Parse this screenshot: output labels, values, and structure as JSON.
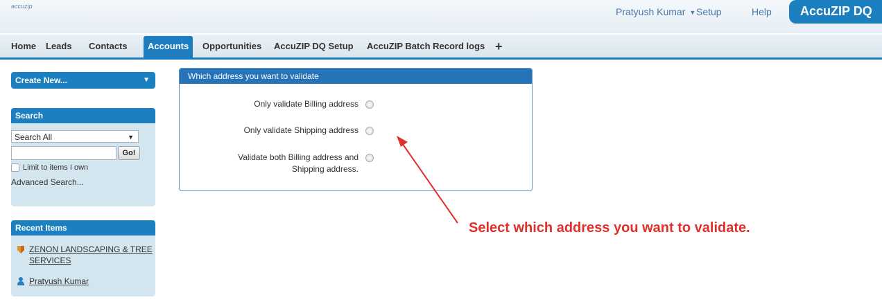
{
  "header": {
    "logo_text": "accuzip",
    "user_name": "Pratyush Kumar",
    "user_caret": "▼",
    "setup_label": "Setup",
    "help_label": "Help",
    "app_label": "AccuZIP DQ"
  },
  "tabs": [
    {
      "label": "Home"
    },
    {
      "label": "Leads"
    },
    {
      "label": "Contacts"
    },
    {
      "label": "Accounts",
      "active": true
    },
    {
      "label": "Opportunities"
    },
    {
      "label": "AccuZIP DQ Setup"
    },
    {
      "label": "AccuZIP Batch Record logs"
    }
  ],
  "tab_plus": "+",
  "sidebar": {
    "create_new_label": "Create New...",
    "create_new_caret": "▼",
    "search": {
      "title": "Search",
      "scope_value": "Search All",
      "scope_caret": "▼",
      "input_value": "",
      "go_label": "Go!",
      "limit_label": "Limit to items I own",
      "advanced_label": "Advanced Search..."
    },
    "recent": {
      "title": "Recent Items",
      "items": [
        {
          "label": "ZENON LANDSCAPING & TREE SERVICES",
          "icon": "account-icon"
        },
        {
          "label": "Pratyush Kumar",
          "icon": "user-icon"
        }
      ]
    }
  },
  "panel": {
    "title": "Which address you want to validate",
    "options": [
      {
        "label": "Only validate Billing address"
      },
      {
        "label": "Only validate Shipping address"
      },
      {
        "label_line1": "Validate both Billing address and",
        "label_line2": "Shipping address."
      }
    ]
  },
  "annotation": {
    "text": "Select which address you want to validate.",
    "color": "#e0302c"
  },
  "colors": {
    "brand_blue": "#1b7fc0",
    "tab_active": "#1e7cc0",
    "panel_header": "#2673b8",
    "sidebar_bg": "#d3e6f0"
  }
}
